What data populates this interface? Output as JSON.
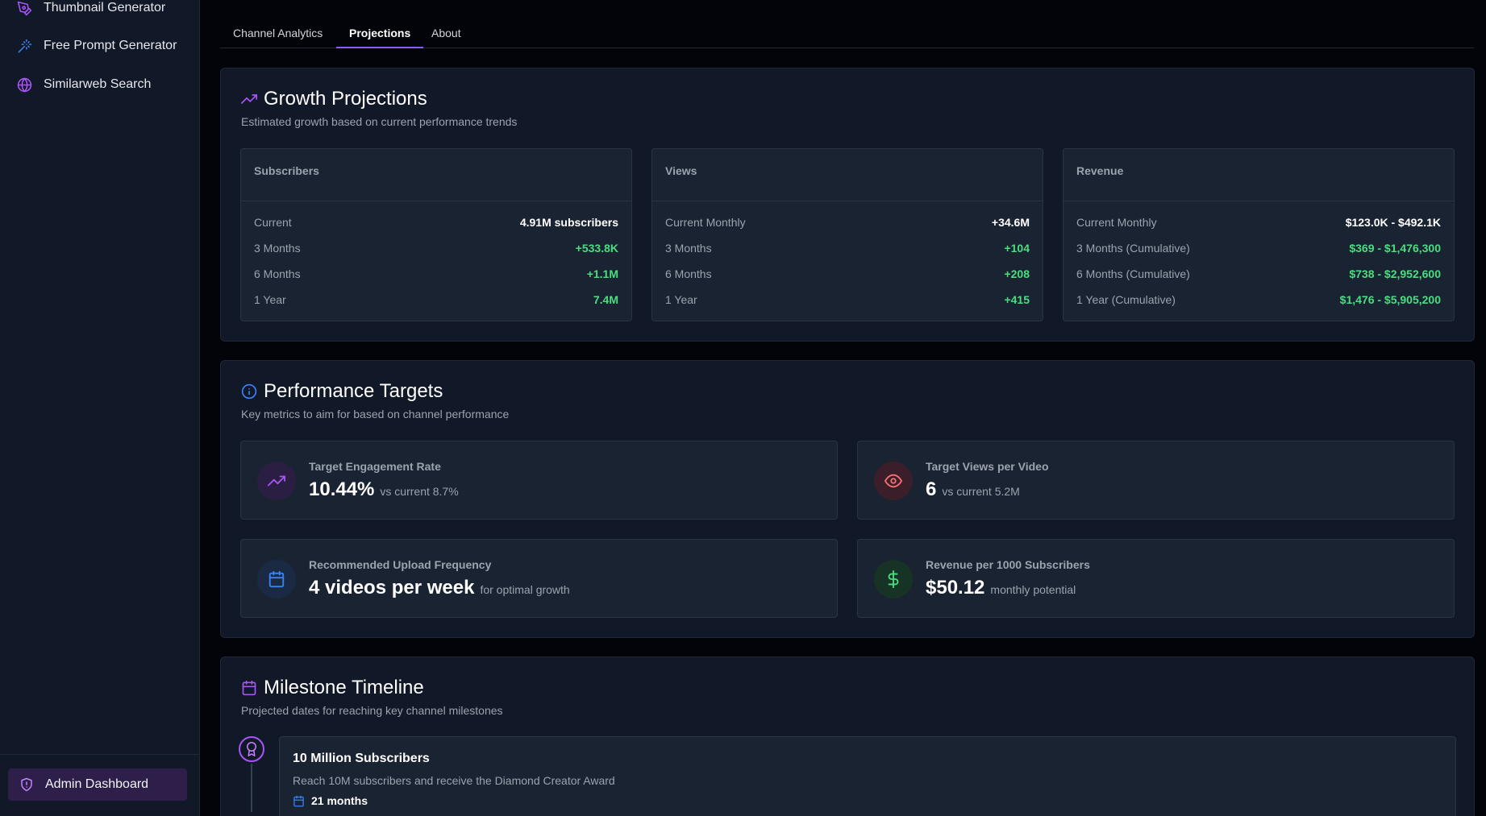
{
  "sidebar": {
    "items": [
      {
        "label": "Thumbnail Generator",
        "icon": "pen-tool-icon"
      },
      {
        "label": "Free Prompt Generator",
        "icon": "magic-wand-icon"
      },
      {
        "label": "Similarweb Search",
        "icon": "globe-icon"
      }
    ],
    "admin_label": "Admin Dashboard"
  },
  "tabs": [
    {
      "label": "Channel Analytics",
      "active": false
    },
    {
      "label": "Projections",
      "active": true
    },
    {
      "label": "About",
      "active": false
    }
  ],
  "growth": {
    "title": "Growth Projections",
    "subtitle": "Estimated growth based on current performance trends",
    "boxes": [
      {
        "heading": "Subscribers",
        "rows": [
          {
            "label": "Current",
            "value": "4.91M subscribers"
          },
          {
            "label": "3 Months",
            "value": "+533.8K"
          },
          {
            "label": "6 Months",
            "value": "+1.1M"
          },
          {
            "label": "1 Year",
            "value": "7.4M"
          }
        ]
      },
      {
        "heading": "Views",
        "rows": [
          {
            "label": "Current Monthly",
            "value": "+34.6M"
          },
          {
            "label": "3 Months",
            "value": "+104"
          },
          {
            "label": "6 Months",
            "value": "+208"
          },
          {
            "label": "1 Year",
            "value": "+415"
          }
        ]
      },
      {
        "heading": "Revenue",
        "rows": [
          {
            "label": "Current Monthly",
            "value": "$123.0K - $492.1K"
          },
          {
            "label": "3 Months (Cumulative)",
            "value": "$369 - $1,476,300"
          },
          {
            "label": "6 Months (Cumulative)",
            "value": "$738 - $2,952,600"
          },
          {
            "label": "1 Year (Cumulative)",
            "value": "$1,476 - $5,905,200"
          }
        ]
      }
    ]
  },
  "targets": {
    "title": "Performance Targets",
    "subtitle": "Key metrics to aim for based on channel performance",
    "items": [
      {
        "label": "Target Engagement Rate",
        "value": "10.44%",
        "note": "vs current 8.7%"
      },
      {
        "label": "Target Views per Video",
        "value": "6",
        "note": "vs current 5.2M"
      },
      {
        "label": "Recommended Upload Frequency",
        "value": "4 videos per week",
        "note": "for optimal growth"
      },
      {
        "label": "Revenue per 1000 Subscribers",
        "value": "$50.12",
        "note": "monthly potential"
      }
    ]
  },
  "milestones": {
    "title": "Milestone Timeline",
    "subtitle": "Projected dates for reaching key channel milestones",
    "items": [
      {
        "title": "10 Million Subscribers",
        "description": "Reach 10M subscribers and receive the Diamond Creator Award",
        "duration": "21 months"
      }
    ]
  },
  "colors": {
    "accent": "#a855f7",
    "positive": "#4ade80",
    "blue": "#3b82f6",
    "red": "#f87171",
    "green": "#4ade80"
  }
}
